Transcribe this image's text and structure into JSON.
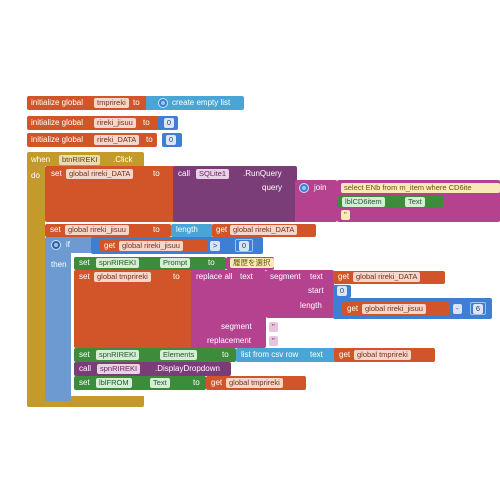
{
  "init_blocks": [
    {
      "prefix": "initialize global",
      "var": "tmprireki",
      "to": "to",
      "value": "create empty list"
    },
    {
      "prefix": "initialize global",
      "var": "rireki_jisuu",
      "to": "to",
      "value": "0"
    },
    {
      "prefix": "initialize global",
      "var": "rireki_DATA",
      "to": "to",
      "value": "0"
    }
  ],
  "event": {
    "when": "when",
    "component": "btnRIREKI",
    "event": ".Click",
    "do": "do"
  },
  "set_data": {
    "set": "set",
    "var": "global rireki_DATA",
    "to": "to",
    "call": "call",
    "component": "SQLite1",
    "method": ".RunQuery",
    "param": "query",
    "join": "join",
    "sql": "select ENb from m_item where CD6ite",
    "comp2": "lblCD6item",
    "prop2": "Text",
    "str_end": "\""
  },
  "set_jisuu": {
    "set": "set",
    "var": "global rireki_jisuu",
    "to": "to",
    "length": "length",
    "get": "get",
    "getvar": "global rireki_DATA"
  },
  "if_block": {
    "if": "if",
    "get": "get",
    "getvar": "global rireki_jisuu",
    "op": ">",
    "num": "0",
    "then": "then"
  },
  "set_prompt": {
    "set": "set",
    "comp": "spnRIREKI",
    "prop": "Prompt",
    "to": "to",
    "str": "履歴を選択"
  },
  "set_tmp": {
    "set": "set",
    "var": "global tmprireki",
    "to": "to",
    "replace": "replace all",
    "text": "text",
    "segment_label": "segment",
    "text2": "text",
    "getvar": "global rireki_DATA",
    "start": "start",
    "start_num": "0",
    "length": "length",
    "len_get": "global rireki_jisuu",
    "minus": "-",
    "minus_num": "6",
    "segment2": "segment",
    "seg_str": "\"",
    "replacement": "replacement",
    "rep_str": "\""
  },
  "set_elements": {
    "set": "set",
    "comp": "spnRIREKI",
    "prop": "Elements",
    "to": "to",
    "list": "list from csv row",
    "text": "text",
    "get": "get",
    "getvar": "global tmprireki"
  },
  "call_dropdown": {
    "call": "call",
    "comp": "spnRIREKI",
    "method": ".DisplayDropdown"
  },
  "set_from": {
    "set": "set",
    "comp": "lblFROM",
    "prop": "Text",
    "to": "to",
    "get": "get",
    "getvar": "global tmprireki"
  },
  "colors": {
    "variable": "#d2552a",
    "list": "#49a6d4",
    "math": "#3f7fd3",
    "control": "#c49a2a",
    "component": "#3c8c3c",
    "text": "#b5428f",
    "db": "#7a3d78",
    "logic": "#6d9bd1"
  }
}
